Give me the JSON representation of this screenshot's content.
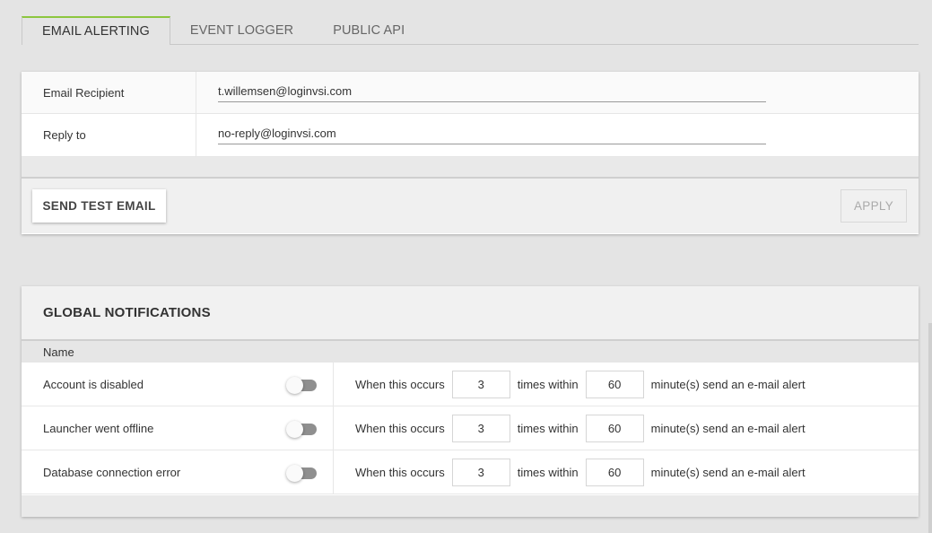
{
  "tabs": [
    {
      "label": "EMAIL ALERTING",
      "active": true
    },
    {
      "label": "EVENT LOGGER",
      "active": false
    },
    {
      "label": "PUBLIC API",
      "active": false
    }
  ],
  "email_settings": {
    "recipient_label": "Email Recipient",
    "recipient_value": "t.willemsen@loginvsi.com",
    "reply_to_label": "Reply to",
    "reply_to_value": "no-reply@loginvsi.com",
    "send_test_label": "SEND TEST EMAIL",
    "apply_label": "APPLY"
  },
  "global_notifications": {
    "title": "GLOBAL NOTIFICATIONS",
    "column_name": "Name",
    "rows": [
      {
        "name": "Account is disabled",
        "enabled": false,
        "prefix": "When this occurs",
        "count": "3",
        "middle": "times within",
        "minutes": "60",
        "suffix": "minute(s) send an e-mail alert"
      },
      {
        "name": "Launcher went offline",
        "enabled": false,
        "prefix": "When this occurs",
        "count": "3",
        "middle": "times within",
        "minutes": "60",
        "suffix": "minute(s) send an e-mail alert"
      },
      {
        "name": "Database connection error",
        "enabled": false,
        "prefix": "When this occurs",
        "count": "3",
        "middle": "times within",
        "minutes": "60",
        "suffix": "minute(s) send an e-mail alert"
      }
    ]
  },
  "colors": {
    "accent": "#8dc63f",
    "background": "#e4e4e4",
    "toggle_off": "#8f8f8f"
  }
}
